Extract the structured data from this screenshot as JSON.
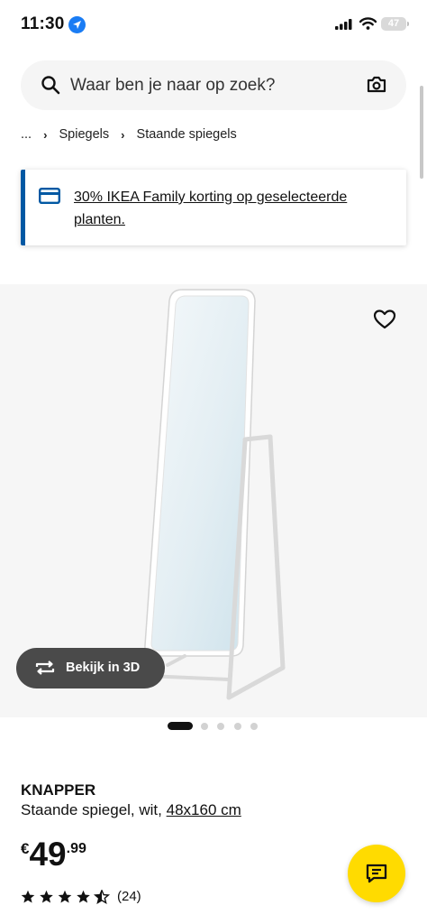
{
  "status_bar": {
    "time": "11:30",
    "battery": "47"
  },
  "search": {
    "placeholder": "Waar ben je naar op zoek?"
  },
  "breadcrumb": {
    "ellipsis": "...",
    "items": [
      "Spiegels",
      "Staande spiegels"
    ]
  },
  "banner": {
    "text": "30% IKEA Family korting op geselecteerde planten."
  },
  "gallery": {
    "view_3d_label": "Bekijk in 3D",
    "slide_count": 5,
    "active_slide": 1
  },
  "product": {
    "name": "KNAPPER",
    "description": "Staande spiegel, wit,",
    "size": "48x160 cm",
    "price": {
      "currency": "€",
      "integer": "49",
      "decimals": ".99"
    },
    "rating": {
      "value": 4.5,
      "max": 5,
      "count": "(24)"
    }
  },
  "colors": {
    "accent_blue": "#0058a3",
    "chat_yellow": "#ffdb00",
    "location_blue": "#1a7cf4"
  },
  "icons": [
    "location-arrow-icon",
    "cellular-signal-icon",
    "wifi-icon",
    "battery-icon",
    "search-icon",
    "camera-icon",
    "card-icon",
    "heart-icon",
    "rotate-3d-icon",
    "star-icon",
    "chat-icon"
  ]
}
